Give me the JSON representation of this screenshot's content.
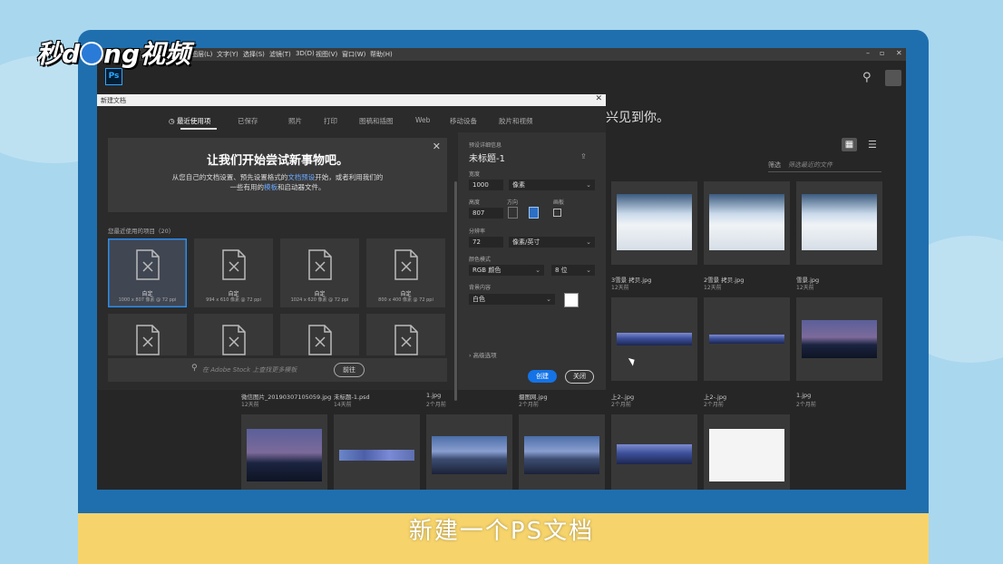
{
  "branding": {
    "logo_text_a": "秒d",
    "logo_text_b": "ng视频"
  },
  "caption": "新建一个PS文档",
  "menubar": {
    "items": [
      "(I)",
      "图层(L)",
      "文字(Y)",
      "选择(S)",
      "滤镜(T)",
      "3D(D)",
      "视图(V)",
      "窗口(W)",
      "帮助(H)"
    ],
    "controls": [
      "–",
      "▫",
      "✕"
    ]
  },
  "app": {
    "logo": "Ps",
    "welcome": "兴见到你。",
    "filter_label": "筛选",
    "filter_value": "筛选最近的文件"
  },
  "dialog": {
    "title": "新建文档",
    "tabs": [
      "最近使用项",
      "已保存",
      "照片",
      "打印",
      "图稿和插图",
      "Web",
      "移动设备",
      "胶片和视频"
    ],
    "banner_title": "让我们开始尝试新事物吧。",
    "banner_line1_a": "从您自己的文档设置、预先设置格式的",
    "banner_line1_link": "文档预设",
    "banner_line1_b": "开始，或者利用我们的",
    "banner_line2_a": "一些有用的",
    "banner_line2_link": "模板",
    "banner_line2_b": "和启动器文件。",
    "recent_label": "您最近使用的项目（20）",
    "presets": [
      {
        "name": "自定",
        "size": "1000 x 807 像素 @ 72 ppi"
      },
      {
        "name": "自定",
        "size": "994 x 610 像素 @ 72 ppi"
      },
      {
        "name": "自定",
        "size": "1024 x 620 像素 @ 72 ppi"
      },
      {
        "name": "自定",
        "size": "800 x 400 像素 @ 72 ppi"
      }
    ],
    "stock_placeholder": "在 Adobe Stock 上查找更多模板",
    "stock_go": "前往",
    "details": {
      "section_label": "预设详细信息",
      "doc_name": "未标题-1",
      "width_label": "宽度",
      "width_value": "1000",
      "width_unit": "像素",
      "height_label": "高度",
      "height_value": "807",
      "orientation_label": "方向",
      "artboard_label": "画板",
      "resolution_label": "分辨率",
      "resolution_value": "72",
      "resolution_unit": "像素/英寸",
      "color_mode_label": "颜色模式",
      "color_mode_value": "RGB 颜色",
      "bit_depth": "8 位",
      "background_label": "背景内容",
      "background_value": "白色",
      "advanced": "高级选项",
      "create": "创建",
      "close": "关闭"
    }
  },
  "files": [
    {
      "name": "3雪景 拷贝.jpg",
      "age": "12天前"
    },
    {
      "name": "2雪景 拷贝.jpg",
      "age": "12天前"
    },
    {
      "name": "雪景.jpg",
      "age": "12天前"
    },
    {
      "name": "微信图片_20190307105059.jpg",
      "age": "12天前"
    },
    {
      "name": "未标题-1.psd",
      "age": "14天前"
    },
    {
      "name": "1.jpg",
      "age": "2个月前"
    },
    {
      "name": "摄图网.jpg",
      "age": "2个月前"
    },
    {
      "name": "上2-.jpg",
      "age": "2个月前"
    },
    {
      "name": "上2-.jpg",
      "age": "2个月前"
    },
    {
      "name": "1.jpg",
      "age": "2个月前"
    }
  ]
}
